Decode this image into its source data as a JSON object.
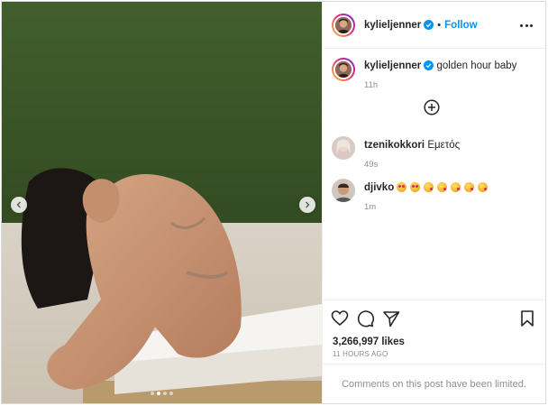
{
  "post": {
    "author": {
      "username": "kylieljenner",
      "verified": true
    },
    "follow_label": "Follow",
    "bullet": "•",
    "caption": {
      "username": "kylieljenner",
      "text": "golden hour baby",
      "age": "11h"
    },
    "carousel": {
      "slide_count": 4,
      "active_index": 1
    }
  },
  "comments": [
    {
      "username": "tzenikokkori",
      "text": "Εμετός",
      "age": "49s"
    },
    {
      "username": "djivko",
      "emojis": [
        "heart-eyes",
        "heart-eyes",
        "kiss",
        "kiss",
        "kiss",
        "kiss",
        "kiss"
      ],
      "age": "1m"
    }
  ],
  "stats": {
    "likes": "3,266,997 likes",
    "time": "11 HOURS AGO"
  },
  "footer": {
    "limited_text": "Comments on this post have been limited."
  },
  "icons": {
    "like": "heart-icon",
    "comment": "comment-icon",
    "share": "send-icon",
    "save": "bookmark-icon",
    "more": "more-options-icon",
    "add": "plus-circle-icon",
    "prev": "chevron-left-icon",
    "next": "chevron-right-icon",
    "verified": "verified-badge-icon"
  },
  "colors": {
    "accent": "#0095f6",
    "text": "#262626",
    "muted": "#8e8e8e",
    "border": "#dbdbdb"
  }
}
